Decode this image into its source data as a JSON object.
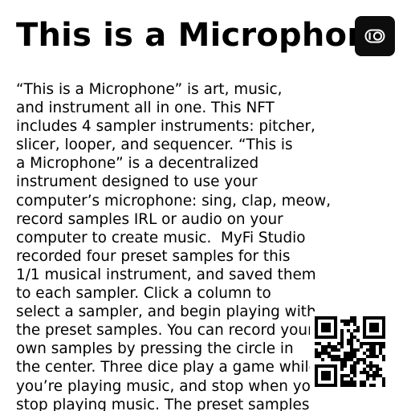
{
  "title": "This is a Microphone",
  "toggle_button": {
    "icon": "toggle-icon"
  },
  "description_lines": [
    "“This is a Microphone” is art, music,",
    "and instrument all in one. This NFT",
    "includes 4 sampler instruments: pitcher,",
    "slicer, looper, and sequencer. “This is",
    "a Microphone” is a decentralized",
    "instrument designed to use your",
    "computer’s microphone: sing, clap, meow,",
    "record samples IRL or audio on your",
    "computer to create music.  MyFi Studio",
    "recorded four preset samples for this",
    "1/1 musical instrument, and saved them",
    "to each sampler. Click a column to",
    "select a sampler, and begin playing with",
    "the preset samples. You can record your",
    "own samples by pressing the circle in",
    "the center. Three dice play a game while",
    "you’re playing music, and stop when you",
    "stop playing music. The preset samples"
  ],
  "qr_code": {
    "icon": "qr-code-icon"
  },
  "colors": {
    "background": "#ffffff",
    "text": "#000000",
    "button_bg": "#0d0d0d",
    "button_icon": "#ffffff"
  }
}
